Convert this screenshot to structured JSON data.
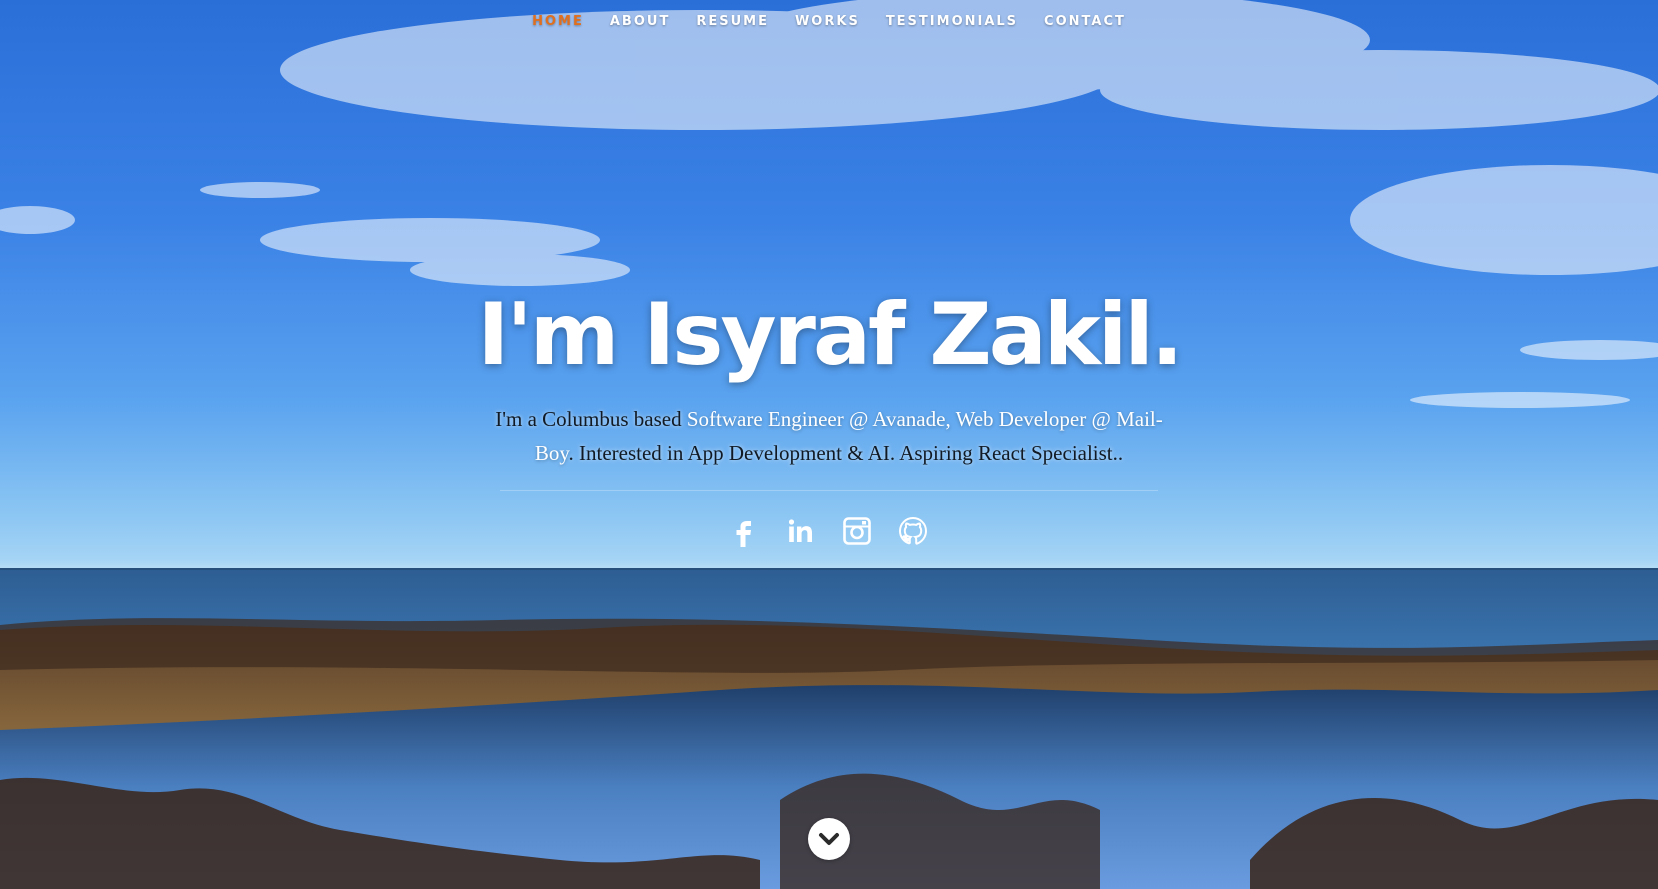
{
  "nav": {
    "items": [
      {
        "label": "HOME",
        "active": true
      },
      {
        "label": "ABOUT",
        "active": false
      },
      {
        "label": "RESUME",
        "active": false
      },
      {
        "label": "WORKS",
        "active": false
      },
      {
        "label": "TESTIMONIALS",
        "active": false
      },
      {
        "label": "CONTACT",
        "active": false
      }
    ]
  },
  "banner": {
    "headline": "I'm Isyraf Zakil.",
    "intro": {
      "part1": "I'm a Columbus based ",
      "role1": "Software Engineer @ Avanade",
      "sep": ", ",
      "role2": "Web Developer @ Mail-Boy",
      "part2": ". Interested in App Development & AI. Aspiring React Specialist.."
    }
  },
  "social": [
    {
      "icon": "facebook-icon"
    },
    {
      "icon": "linkedin-icon"
    },
    {
      "icon": "instagram-icon"
    },
    {
      "icon": "github-icon"
    }
  ],
  "scroll_down": {
    "icon": "chevron-down-icon"
  },
  "colors": {
    "accent": "#e0701f",
    "text": "#ffffff",
    "intro_text": "#111a24"
  }
}
